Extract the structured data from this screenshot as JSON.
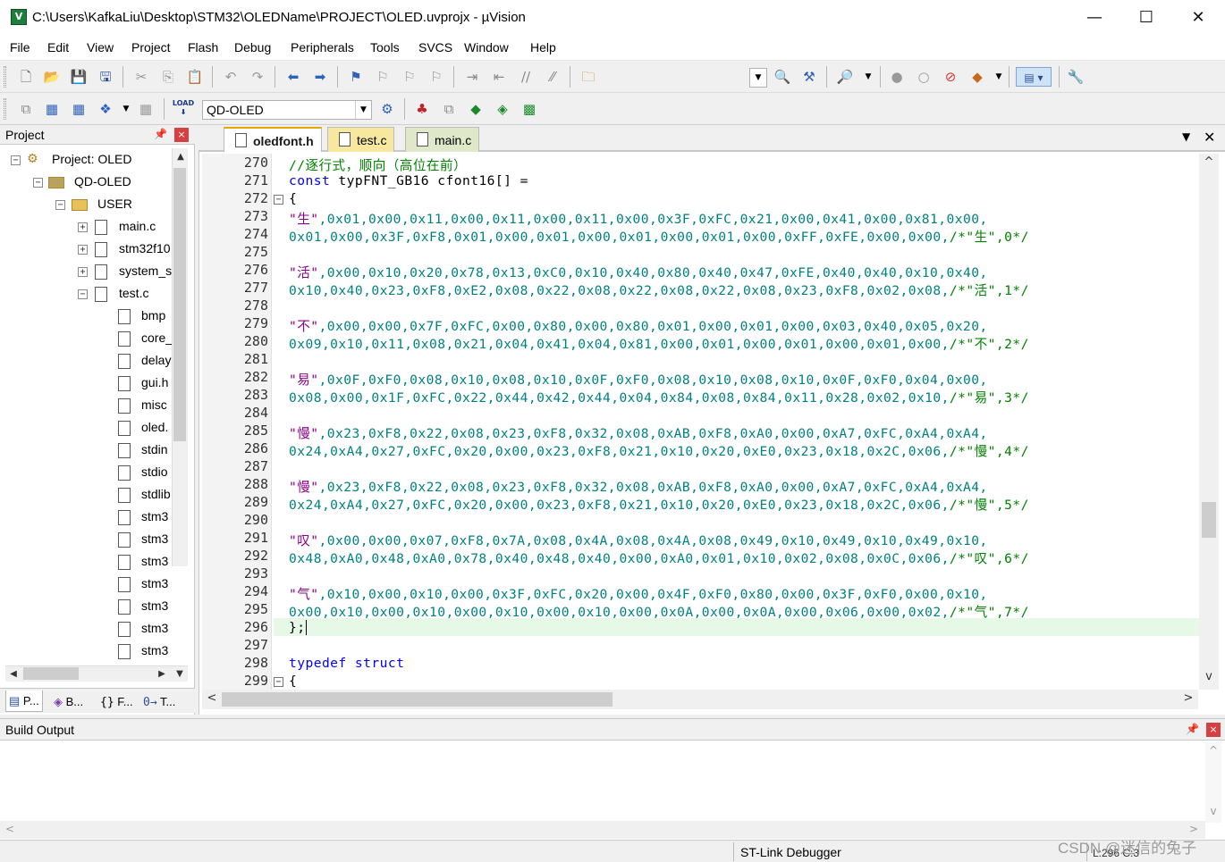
{
  "window": {
    "title": "C:\\Users\\KafkaLiu\\Desktop\\STM32\\OLEDName\\PROJECT\\OLED.uvprojx - µVision",
    "icon_letter": "V",
    "minimize": "—",
    "maximize": "☐",
    "close": "✕"
  },
  "menu": [
    "File",
    "Edit",
    "View",
    "Project",
    "Flash",
    "Debug",
    "Peripherals",
    "Tools",
    "SVCS",
    "Window",
    "Help"
  ],
  "toolbar": {
    "target": "QD-OLED",
    "target_dropdown": "▼",
    "load_label": "LOAD"
  },
  "project_panel": {
    "title": "Project",
    "pin": "📌",
    "close": "×",
    "tree": [
      {
        "label": "Project: OLED",
        "expander": "−"
      },
      {
        "label": "QD-OLED",
        "expander": "−"
      },
      {
        "label": "USER",
        "expander": "−"
      },
      {
        "label": "main.c",
        "expander": "+"
      },
      {
        "label": "stm32f10",
        "expander": "+"
      },
      {
        "label": "system_s",
        "expander": "+"
      },
      {
        "label": "test.c",
        "expander": "−"
      },
      {
        "label": "bmp"
      },
      {
        "label": "core_"
      },
      {
        "label": "delay"
      },
      {
        "label": "gui.h"
      },
      {
        "label": "misc"
      },
      {
        "label": "oled."
      },
      {
        "label": "stdin"
      },
      {
        "label": "stdio"
      },
      {
        "label": "stdlib"
      },
      {
        "label": "stm3"
      },
      {
        "label": "stm3"
      },
      {
        "label": "stm3"
      },
      {
        "label": "stm3"
      },
      {
        "label": "stm3"
      },
      {
        "label": "stm3"
      },
      {
        "label": "stm3"
      }
    ],
    "tabs": [
      {
        "icon": "▤",
        "label": "P..."
      },
      {
        "icon": "◈",
        "label": "B..."
      },
      {
        "icon": "{}",
        "label": "F..."
      },
      {
        "icon": "0→",
        "label": "T..."
      }
    ]
  },
  "editor": {
    "tabs": [
      {
        "label": "oledfont.h",
        "active": true
      },
      {
        "label": "test.c",
        "active": false
      },
      {
        "label": "main.c",
        "active": false
      }
    ],
    "tab_menu": "▼",
    "tab_close": "✕",
    "lines": [
      {
        "n": "270",
        "fold": "",
        "parts": [
          {
            "c": "c-comment",
            "t": "//逐行式，顺向（高位在前）"
          }
        ]
      },
      {
        "n": "271",
        "fold": "",
        "parts": [
          {
            "c": "c-kw",
            "t": "const"
          },
          {
            "c": "",
            "t": " typFNT_GB16 cfont16[] ="
          }
        ]
      },
      {
        "n": "272",
        "fold": "−",
        "parts": [
          {
            "c": "",
            "t": "{"
          }
        ]
      },
      {
        "n": "273",
        "fold": "",
        "parts": [
          {
            "c": "c-str",
            "t": "\"生\""
          },
          {
            "c": "c-hex",
            "t": ",0x01,0x00,0x11,0x00,0x11,0x00,0x11,0x00,0x3F,0xFC,0x21,0x00,0x41,0x00,0x81,0x00,"
          }
        ]
      },
      {
        "n": "274",
        "fold": "",
        "parts": [
          {
            "c": "c-hex",
            "t": "0x01,0x00,0x3F,0xF8,0x01,0x00,0x01,0x00,0x01,0x00,0x01,0x00,0xFF,0xFE,0x00,0x00,"
          },
          {
            "c": "c-comment",
            "t": "/*\"生\",0*/"
          }
        ]
      },
      {
        "n": "275",
        "fold": "",
        "parts": []
      },
      {
        "n": "276",
        "fold": "",
        "parts": [
          {
            "c": "c-str",
            "t": "\"活\""
          },
          {
            "c": "c-hex",
            "t": ",0x00,0x10,0x20,0x78,0x13,0xC0,0x10,0x40,0x80,0x40,0x47,0xFE,0x40,0x40,0x10,0x40,"
          }
        ]
      },
      {
        "n": "277",
        "fold": "",
        "parts": [
          {
            "c": "c-hex",
            "t": "0x10,0x40,0x23,0xF8,0xE2,0x08,0x22,0x08,0x22,0x08,0x22,0x08,0x23,0xF8,0x02,0x08,"
          },
          {
            "c": "c-comment",
            "t": "/*\"活\",1*/"
          }
        ]
      },
      {
        "n": "278",
        "fold": "",
        "parts": []
      },
      {
        "n": "279",
        "fold": "",
        "parts": [
          {
            "c": "c-str",
            "t": "\"不\""
          },
          {
            "c": "c-hex",
            "t": ",0x00,0x00,0x7F,0xFC,0x00,0x80,0x00,0x80,0x01,0x00,0x01,0x00,0x03,0x40,0x05,0x20,"
          }
        ]
      },
      {
        "n": "280",
        "fold": "",
        "parts": [
          {
            "c": "c-hex",
            "t": "0x09,0x10,0x11,0x08,0x21,0x04,0x41,0x04,0x81,0x00,0x01,0x00,0x01,0x00,0x01,0x00,"
          },
          {
            "c": "c-comment",
            "t": "/*\"不\",2*/"
          }
        ]
      },
      {
        "n": "281",
        "fold": "",
        "parts": []
      },
      {
        "n": "282",
        "fold": "",
        "parts": [
          {
            "c": "c-str",
            "t": "\"易\""
          },
          {
            "c": "c-hex",
            "t": ",0x0F,0xF0,0x08,0x10,0x08,0x10,0x0F,0xF0,0x08,0x10,0x08,0x10,0x0F,0xF0,0x04,0x00,"
          }
        ]
      },
      {
        "n": "283",
        "fold": "",
        "parts": [
          {
            "c": "c-hex",
            "t": "0x08,0x00,0x1F,0xFC,0x22,0x44,0x42,0x44,0x04,0x84,0x08,0x84,0x11,0x28,0x02,0x10,"
          },
          {
            "c": "c-comment",
            "t": "/*\"易\",3*/"
          }
        ]
      },
      {
        "n": "284",
        "fold": "",
        "parts": []
      },
      {
        "n": "285",
        "fold": "",
        "parts": [
          {
            "c": "c-str",
            "t": "\"慢\""
          },
          {
            "c": "c-hex",
            "t": ",0x23,0xF8,0x22,0x08,0x23,0xF8,0x32,0x08,0xAB,0xF8,0xA0,0x00,0xA7,0xFC,0xA4,0xA4,"
          }
        ]
      },
      {
        "n": "286",
        "fold": "",
        "parts": [
          {
            "c": "c-hex",
            "t": "0x24,0xA4,0x27,0xFC,0x20,0x00,0x23,0xF8,0x21,0x10,0x20,0xE0,0x23,0x18,0x2C,0x06,"
          },
          {
            "c": "c-comment",
            "t": "/*\"慢\",4*/"
          }
        ]
      },
      {
        "n": "287",
        "fold": "",
        "parts": []
      },
      {
        "n": "288",
        "fold": "",
        "parts": [
          {
            "c": "c-str",
            "t": "\"慢\""
          },
          {
            "c": "c-hex",
            "t": ",0x23,0xF8,0x22,0x08,0x23,0xF8,0x32,0x08,0xAB,0xF8,0xA0,0x00,0xA7,0xFC,0xA4,0xA4,"
          }
        ]
      },
      {
        "n": "289",
        "fold": "",
        "parts": [
          {
            "c": "c-hex",
            "t": "0x24,0xA4,0x27,0xFC,0x20,0x00,0x23,0xF8,0x21,0x10,0x20,0xE0,0x23,0x18,0x2C,0x06,"
          },
          {
            "c": "c-comment",
            "t": "/*\"慢\",5*/"
          }
        ]
      },
      {
        "n": "290",
        "fold": "",
        "parts": []
      },
      {
        "n": "291",
        "fold": "",
        "parts": [
          {
            "c": "c-str",
            "t": "\"叹\""
          },
          {
            "c": "c-hex",
            "t": ",0x00,0x00,0x07,0xF8,0x7A,0x08,0x4A,0x08,0x4A,0x08,0x49,0x10,0x49,0x10,0x49,0x10,"
          }
        ]
      },
      {
        "n": "292",
        "fold": "",
        "parts": [
          {
            "c": "c-hex",
            "t": "0x48,0xA0,0x48,0xA0,0x78,0x40,0x48,0x40,0x00,0xA0,0x01,0x10,0x02,0x08,0x0C,0x06,"
          },
          {
            "c": "c-comment",
            "t": "/*\"叹\",6*/"
          }
        ]
      },
      {
        "n": "293",
        "fold": "",
        "parts": []
      },
      {
        "n": "294",
        "fold": "",
        "parts": [
          {
            "c": "c-str",
            "t": "\"气\""
          },
          {
            "c": "c-hex",
            "t": ",0x10,0x00,0x10,0x00,0x3F,0xFC,0x20,0x00,0x4F,0xF0,0x80,0x00,0x3F,0xF0,0x00,0x10,"
          }
        ]
      },
      {
        "n": "295",
        "fold": "",
        "parts": [
          {
            "c": "c-hex",
            "t": "0x00,0x10,0x00,0x10,0x00,0x10,0x00,0x10,0x00,0x0A,0x00,0x0A,0x00,0x06,0x00,0x02,"
          },
          {
            "c": "c-comment",
            "t": "/*\"气\",7*/"
          }
        ]
      },
      {
        "n": "296",
        "fold": "",
        "parts": [
          {
            "c": "",
            "t": "};"
          }
        ]
      },
      {
        "n": "297",
        "fold": "",
        "parts": []
      },
      {
        "n": "298",
        "fold": "",
        "parts": [
          {
            "c": "c-kw",
            "t": "typedef struct"
          }
        ]
      },
      {
        "n": "299",
        "fold": "−",
        "parts": [
          {
            "c": "",
            "t": "{"
          }
        ]
      }
    ]
  },
  "build_output": {
    "title": "Build Output",
    "pin": "📌",
    "close": "×"
  },
  "status": {
    "debugger": "ST-Link Debugger",
    "position": "L:296 C:3"
  },
  "watermark": "CSDN @迷信的兔子",
  "icons": {
    "scroll_up": "▲",
    "scroll_down": "▼",
    "scroll_left": "◀",
    "scroll_right": "▶",
    "chevron_up": "^",
    "chevron_down": "v",
    "chevron_left": "<",
    "chevron_right": ">"
  }
}
